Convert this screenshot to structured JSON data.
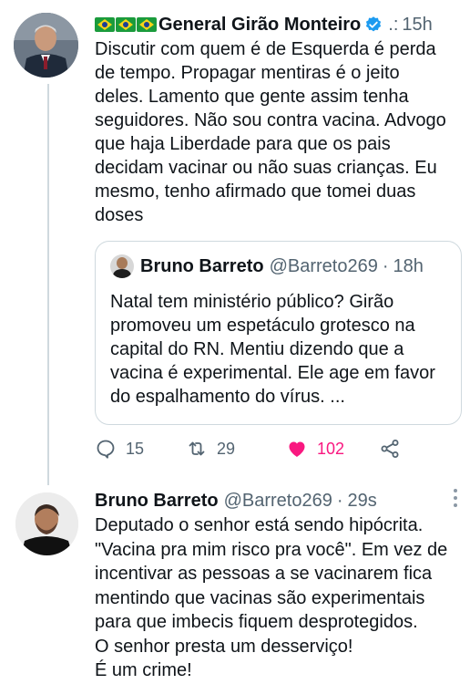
{
  "tweet": {
    "author_name": "General Girão Monteiro",
    "time": "15h",
    "text": "Discutir com quem é de Esquerda é perda\nde tempo. Propagar mentiras é o jeito\ndeles. Lamento que gente assim tenha\nseguidores. Não sou contra vacina. Advogo\nque haja Liberdade para que os pais\ndecidam vacinar ou não suas crianças. Eu\nmesmo, tenho afirmado que tomei duas\ndoses",
    "quoted": {
      "author_name": "Bruno Barreto",
      "handle": "@Barreto269",
      "time": "18h",
      "text": "Natal tem ministério público? Girão\npromoveu um espetáculo grotesco na\ncapital do RN. Mentiu dizendo que a\nvacina é experimental. Ele age em favor\ndo espalhamento do vírus. ..."
    },
    "actions": {
      "replies": "15",
      "retweets": "29",
      "likes": "102"
    }
  },
  "reply": {
    "author_name": "Bruno Barreto",
    "handle": "@Barreto269",
    "time": "29s",
    "text": "Deputado o senhor está sendo hipócrita.\n\"Vacina pra mim risco pra você\". Em vez de\nincentivar as pessoas a se vacinarem fica\nmentindo que vacinas são experimentais\npara que imbecis fiquem desprotegidos.\nO senhor presta um desserviço!\nÉ um crime!"
  },
  "colors": {
    "text": "#0f1419",
    "muted": "#536471",
    "like": "#f91880",
    "verified": "#1d9bf0"
  },
  "icons": [
    "flag-brazil-icon",
    "verified-badge-icon",
    "more-icon",
    "reply-icon",
    "retweet-icon",
    "like-icon",
    "share-icon"
  ]
}
